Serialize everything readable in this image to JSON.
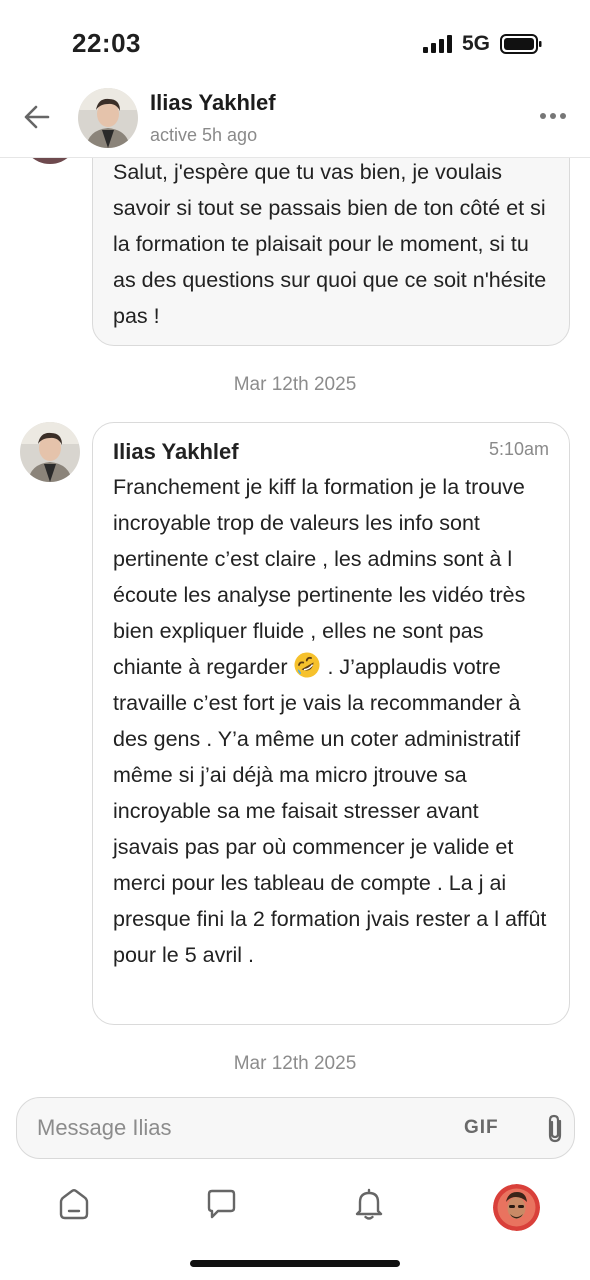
{
  "status_bar": {
    "time": "22:03",
    "network": "5G",
    "icons": [
      "signal-icon",
      "battery-icon"
    ]
  },
  "header": {
    "name": "Ilias Yakhlef",
    "status": "active 5h ago",
    "icons": [
      "back-arrow-icon",
      "more-icon"
    ]
  },
  "messages": [
    {
      "text": "Salut, j'espère que tu vas bien, je voulais savoir si tout se passais bien de ton côté et si la formation te plaisait pour le moment, si tu as des questions sur quoi que ce soit n'hésite pas !"
    },
    {
      "sender": "Ilias Yakhlef",
      "time": "5:10am",
      "text_before_emoji": "Franchement je kiff la formation je la trouve incroyable trop de valeurs les info sont pertinente c’est claire , les admins sont à l écoute les analyse pertinente les vidéo très bien expliquer fluide , elles ne sont pas chiante à regarder ",
      "emoji": "rolling-on-floor-laughing-emoji",
      "text_after_emoji": " . J’applaudis votre travaille c’est fort je vais la recommander à des gens . Y’a même un coter administratif même si j’ai déjà ma micro jtrouve sa incroyable sa me faisait stresser avant jsavais pas par où commencer je valide et merci pour les tableau de compte . La j ai presque fini la 2 formation jvais rester a l affût pour le 5 avril ."
    }
  ],
  "date_separators": [
    "Mar 12th 2025",
    "Mar 12th 2025"
  ],
  "composer": {
    "placeholder": "Message Ilias",
    "gif_label": "GIF",
    "icons": [
      "paperclip-icon"
    ]
  },
  "nav": {
    "items": [
      "home-icon",
      "chat-icon",
      "bell-icon",
      "profile-avatar"
    ]
  },
  "colors": {
    "bubble_bg": "#f7f7f7",
    "border": "#dadada",
    "muted_text": "#8a8a8a"
  }
}
